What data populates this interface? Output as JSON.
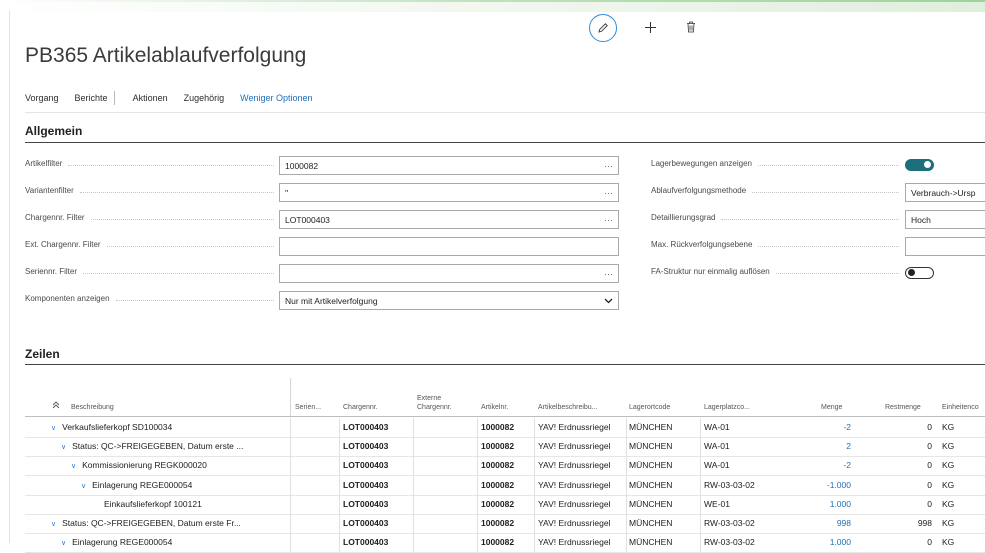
{
  "page": {
    "title": "PB365 Artikelablaufverfolgung"
  },
  "toolbar": {
    "edit_icon": "pencil-icon",
    "new_icon": "plus-icon",
    "delete_icon": "trash-icon"
  },
  "actions": {
    "vorgang": "Vorgang",
    "berichte": "Berichte",
    "aktionen": "Aktionen",
    "zugehoerig": "Zugehörig",
    "weniger": "Weniger Optionen"
  },
  "allgemein": {
    "title": "Allgemein",
    "left": [
      {
        "label": "Artikelfilter",
        "value": "1000082",
        "control": "ellipsis"
      },
      {
        "label": "Variantenfilter",
        "value": "''",
        "control": "ellipsis"
      },
      {
        "label": "Chargennr. Filter",
        "value": "LOT000403",
        "control": "ellipsis"
      },
      {
        "label": "Ext. Chargennr. Filter",
        "value": "",
        "control": "none"
      },
      {
        "label": "Seriennr. Filter",
        "value": "",
        "control": "ellipsis"
      },
      {
        "label": "Komponenten anzeigen",
        "value": "Nur mit Artikelverfolgung",
        "control": "dropdown"
      }
    ],
    "right": [
      {
        "label": "Lagerbewegungen anzeigen",
        "type": "toggle",
        "on": true
      },
      {
        "label": "Ablaufverfolgungsmethode",
        "type": "text",
        "value": "Verbrauch->Ursp"
      },
      {
        "label": "Detaillierungsgrad",
        "type": "text",
        "value": "Hoch"
      },
      {
        "label": "Max. Rückverfolgungsebene",
        "type": "text",
        "value": ""
      },
      {
        "label": "FA-Struktur nur einmalig auflösen",
        "type": "toggle",
        "on": false
      }
    ]
  },
  "zeilen": {
    "title": "Zeilen",
    "headers": {
      "beschreibung": "Beschreibung",
      "serien": "Serien...",
      "charge": "Chargennr.",
      "extern_1": "Externe",
      "extern_2": "Chargennr.",
      "artikel": "Artikelnr.",
      "artikelbeschr": "Artikelbeschreibu...",
      "lagerort": "Lagerortcode",
      "lagerplatz": "Lagerplatzco...",
      "menge": "Menge",
      "restmenge": "Restmenge",
      "einheit": "Einheitenco"
    },
    "rows": [
      {
        "indent": 0,
        "expand": true,
        "desc": "Verkaufslieferkopf SD100034",
        "charge": "LOT000403",
        "artikel": "1000082",
        "beschr": "YAV! Erdnussriegel",
        "lagerort": "MÜNCHEN",
        "platz": "WA-01",
        "menge": "-2",
        "rest": "0",
        "einheit": "KG"
      },
      {
        "indent": 1,
        "expand": true,
        "desc": "Status: QC->FREIGEGEBEN, Datum erste ...",
        "charge": "LOT000403",
        "artikel": "1000082",
        "beschr": "YAV! Erdnussriegel",
        "lagerort": "MÜNCHEN",
        "platz": "WA-01",
        "menge": "2",
        "rest": "0",
        "einheit": "KG"
      },
      {
        "indent": 2,
        "expand": true,
        "desc": "Kommissionierung REGK000020",
        "charge": "LOT000403",
        "artikel": "1000082",
        "beschr": "YAV! Erdnussriegel",
        "lagerort": "MÜNCHEN",
        "platz": "WA-01",
        "menge": "-2",
        "rest": "0",
        "einheit": "KG"
      },
      {
        "indent": 3,
        "expand": true,
        "desc": "Einlagerung REGE000054",
        "charge": "LOT000403",
        "artikel": "1000082",
        "beschr": "YAV! Erdnussriegel",
        "lagerort": "MÜNCHEN",
        "platz": "RW-03-03-02",
        "menge": "-1.000",
        "rest": "0",
        "einheit": "KG"
      },
      {
        "indent": 4,
        "expand": false,
        "desc": "Einkaufslieferkopf 100121",
        "charge": "LOT000403",
        "artikel": "1000082",
        "beschr": "YAV! Erdnussriegel",
        "lagerort": "MÜNCHEN",
        "platz": "WE-01",
        "menge": "1.000",
        "rest": "0",
        "einheit": "KG"
      },
      {
        "indent": 0,
        "expand": true,
        "desc": "Status: QC->FREIGEGEBEN, Datum erste Fr...",
        "charge": "LOT000403",
        "artikel": "1000082",
        "beschr": "YAV! Erdnussriegel",
        "lagerort": "MÜNCHEN",
        "platz": "RW-03-03-02",
        "menge": "998",
        "rest": "998",
        "einheit": "KG"
      },
      {
        "indent": 1,
        "expand": true,
        "desc": "Einlagerung REGE000054",
        "charge": "LOT000403",
        "artikel": "1000082",
        "beschr": "YAV! Erdnussriegel",
        "lagerort": "MÜNCHEN",
        "platz": "RW-03-03-02",
        "menge": "1.000",
        "rest": "0",
        "einheit": "KG"
      }
    ]
  }
}
